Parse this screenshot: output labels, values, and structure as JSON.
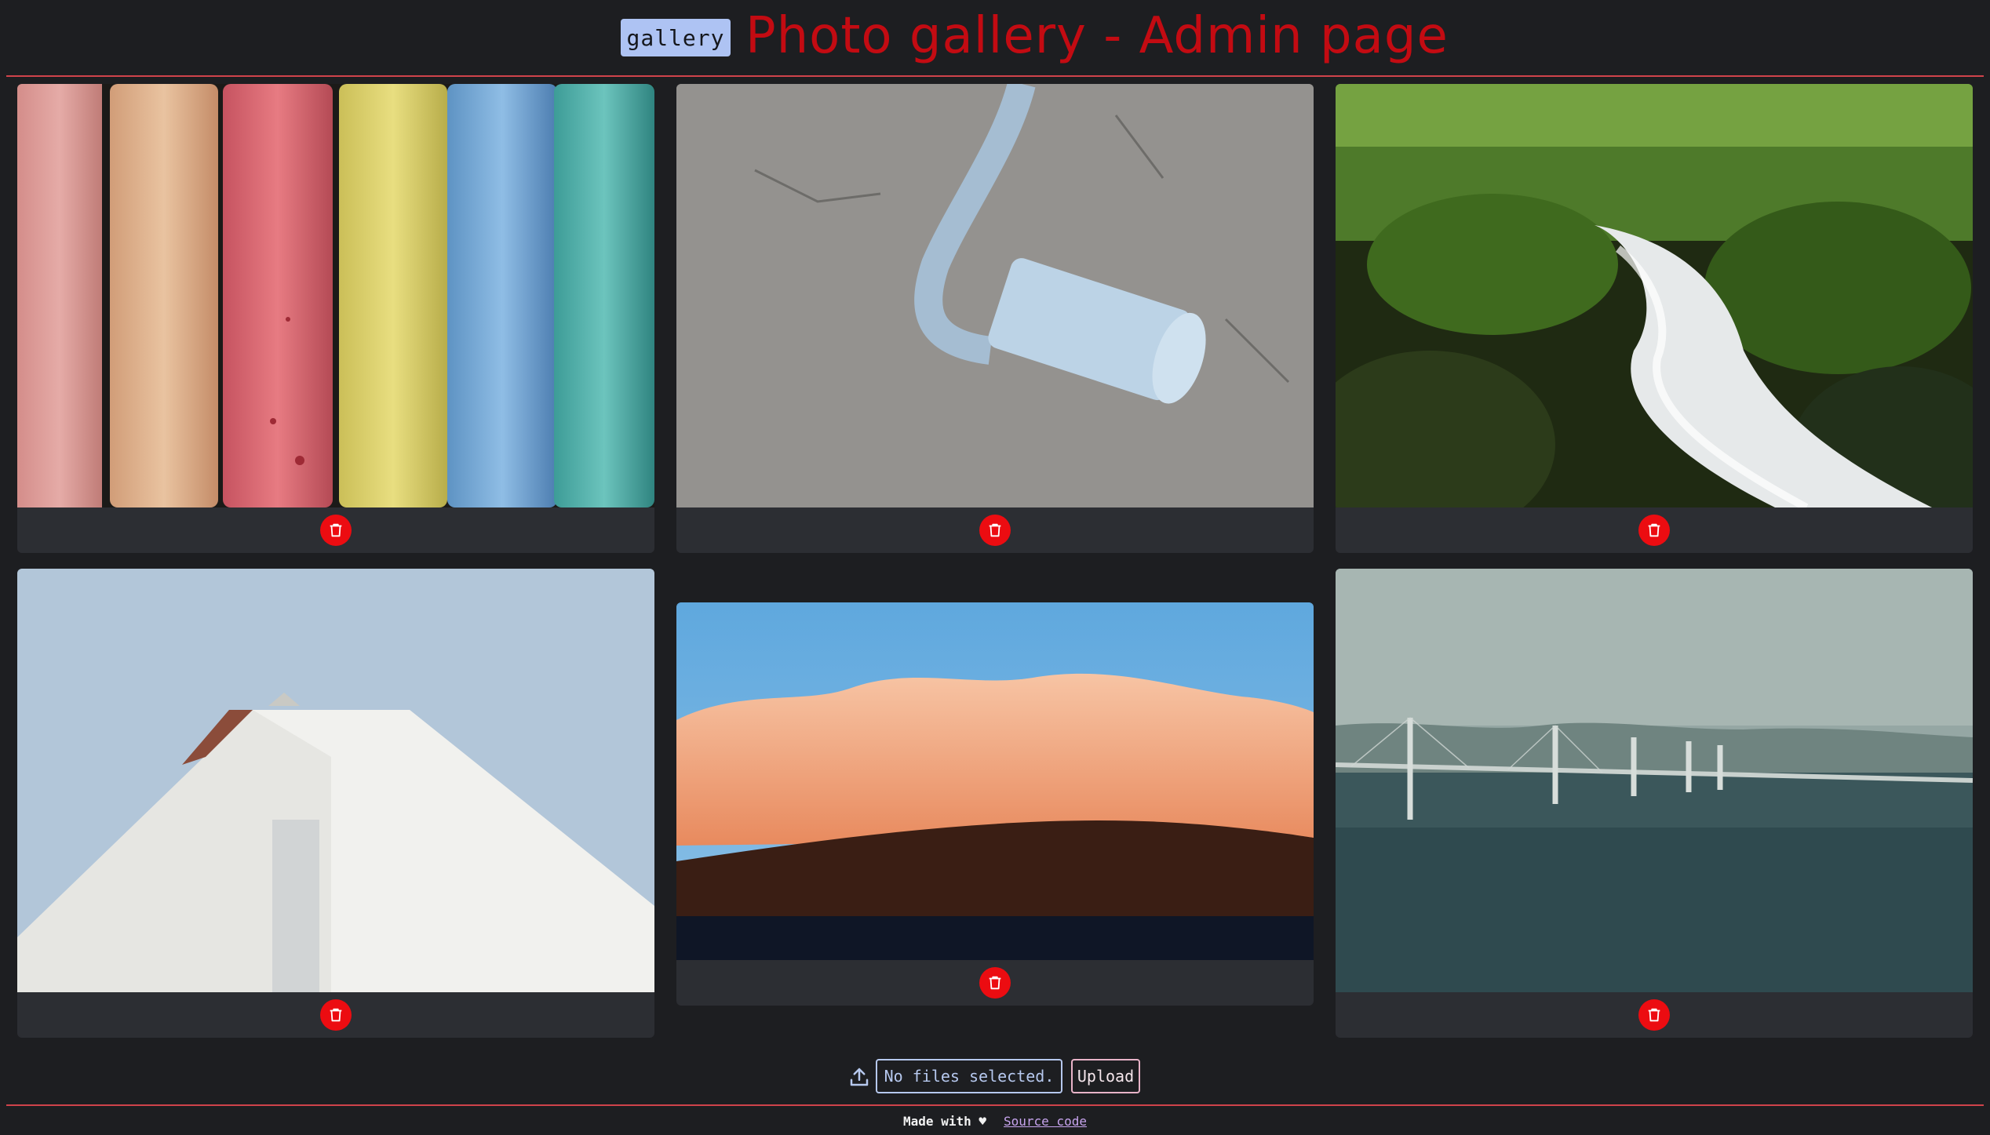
{
  "header": {
    "home_label": "gallery",
    "title": "Photo gallery - Admin page"
  },
  "gallery": {
    "photos": [
      {
        "subject": "Row of pastel sidewalk chalk sticks (pink, peach, red, yellow, blue, teal)",
        "delete_icon": "trash-icon"
      },
      {
        "subject": "Blue chalk piece lying on grey concrete with chalk line",
        "delete_icon": "trash-icon"
      },
      {
        "subject": "Waterfall stream flowing through mossy green forest",
        "delete_icon": "trash-icon"
      },
      {
        "subject": "White house roof gable against pale blue sky",
        "delete_icon": "trash-icon"
      },
      {
        "subject": "Pink sunset clouds over dark forested hills",
        "delete_icon": "trash-icon"
      },
      {
        "subject": "Cable-stayed bridge over calm sea with hazy mountains",
        "delete_icon": "trash-icon"
      }
    ]
  },
  "upload": {
    "icon": "upload-icon",
    "file_status": "No files selected.",
    "button_label": "Upload"
  },
  "footer": {
    "made_with": "Made with ♥",
    "source_link": "Source code"
  },
  "colors": {
    "background": "#1d1e21",
    "card": "#2c2e33",
    "accent_red": "#c30b12",
    "delete_red": "#ec0c11",
    "rule": "#d0434b",
    "home_badge": "#aec3f3",
    "link": "#c7a4ee"
  }
}
